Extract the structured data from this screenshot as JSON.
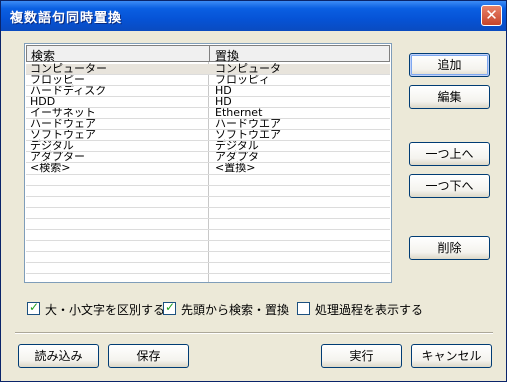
{
  "window": {
    "title": "複数語句同時置換"
  },
  "grid": {
    "headers": [
      "検索",
      "置換"
    ],
    "rows": [
      [
        "コンピューター",
        "コンピュータ"
      ],
      [
        "フロッピー",
        "フロッピィ"
      ],
      [
        "ハードディスク",
        "HD"
      ],
      [
        "HDD",
        "HD"
      ],
      [
        "イーサネット",
        "Ethernet"
      ],
      [
        "ハードウェア",
        "ハードウエア"
      ],
      [
        "ソフトウェア",
        "ソフトウエア"
      ],
      [
        "デジタル",
        "デジタル"
      ],
      [
        "アダプター",
        "アダプタ"
      ],
      [
        "<検索>",
        "<置換>"
      ]
    ]
  },
  "buttons": {
    "add": "追加",
    "edit": "編集",
    "up": "一つ上へ",
    "down": "一つ下へ",
    "delete": "削除",
    "load": "読み込み",
    "save": "保存",
    "run": "実行",
    "cancel": "キャンセル"
  },
  "options": [
    {
      "label": "大・小文字を区別する",
      "checked": true
    },
    {
      "label": "先頭から検索・置換",
      "checked": true
    },
    {
      "label": "処理過程を表示する",
      "checked": false
    }
  ]
}
